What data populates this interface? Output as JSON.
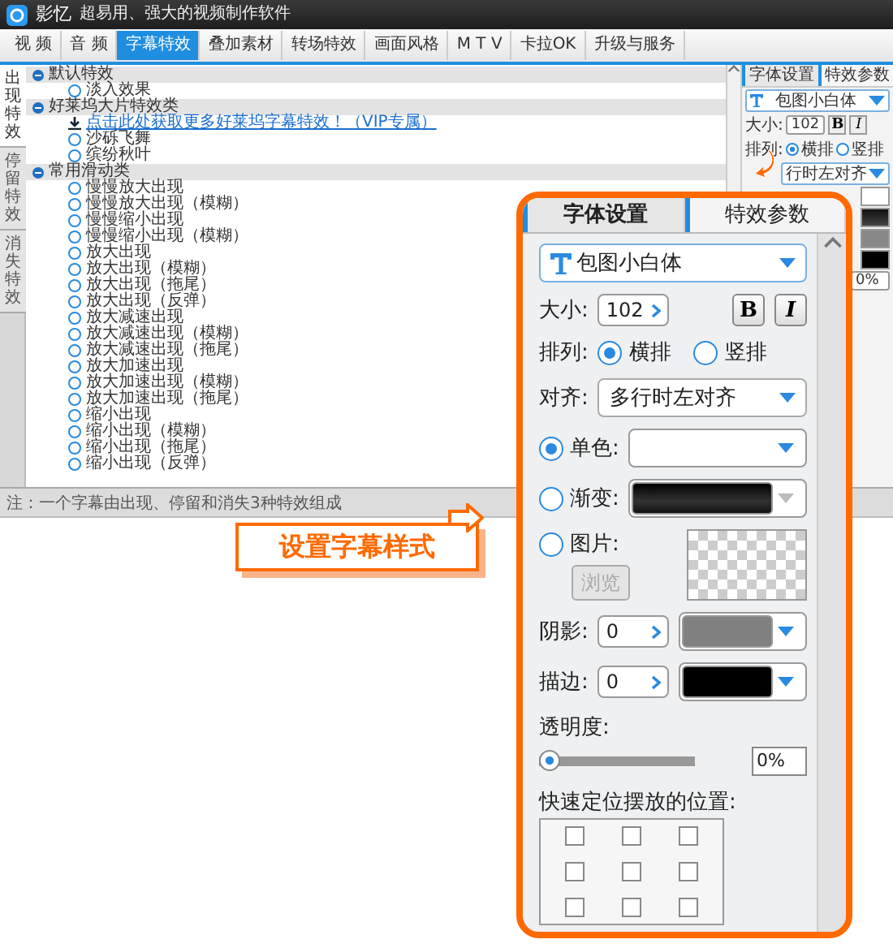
{
  "app": {
    "title": "影忆",
    "subtitle": "超易用、强大的视频制作软件",
    "menu": [
      {
        "label": "视 频",
        "selected": false
      },
      {
        "label": "音 频",
        "selected": false
      },
      {
        "label": "字幕特效",
        "selected": true
      },
      {
        "label": "叠加素材",
        "selected": false
      },
      {
        "label": "转场特效",
        "selected": false
      },
      {
        "label": "画面风格",
        "selected": false
      },
      {
        "label": "M T V",
        "selected": false
      },
      {
        "label": "卡拉OK",
        "selected": false
      },
      {
        "label": "升级与服务",
        "selected": false
      }
    ],
    "side_tabs": [
      {
        "label": "出现特效",
        "selected": true
      },
      {
        "label": "停留特效",
        "selected": false
      },
      {
        "label": "消失特效",
        "selected": false
      }
    ],
    "groups": [
      {
        "title": "默认特效",
        "items": [
          {
            "kind": "radio",
            "label": "淡入效果",
            "selected": false
          }
        ]
      },
      {
        "title": "好莱坞大片特效类",
        "items": [
          {
            "kind": "link",
            "label": "点击此处获取更多好莱坞字幕特效！（VIP专属）"
          },
          {
            "kind": "radio",
            "label": "沙砾飞舞",
            "selected": false
          },
          {
            "kind": "radio",
            "label": "缤纷秋叶",
            "selected": false
          }
        ]
      },
      {
        "title": "常用滑动类",
        "items": [
          {
            "kind": "radio",
            "label": "慢慢放大出现",
            "selected": false
          },
          {
            "kind": "radio",
            "label": "慢慢放大出现（模糊）",
            "selected": false
          },
          {
            "kind": "radio",
            "label": "慢慢缩小出现",
            "selected": false
          },
          {
            "kind": "radio",
            "label": "慢慢缩小出现（模糊）",
            "selected": false
          },
          {
            "kind": "radio",
            "label": "放大出现",
            "selected": false
          },
          {
            "kind": "radio",
            "label": "放大出现（模糊）",
            "selected": false
          },
          {
            "kind": "radio",
            "label": "放大出现（拖尾）",
            "selected": false
          },
          {
            "kind": "radio",
            "label": "放大出现（反弹）",
            "selected": false
          },
          {
            "kind": "radio",
            "label": "放大减速出现",
            "selected": false
          },
          {
            "kind": "radio",
            "label": "放大减速出现（模糊）",
            "selected": false
          },
          {
            "kind": "radio",
            "label": "放大减速出现（拖尾）",
            "selected": false
          },
          {
            "kind": "radio",
            "label": "放大加速出现",
            "selected": false
          },
          {
            "kind": "radio",
            "label": "放大加速出现（模糊）",
            "selected": false
          },
          {
            "kind": "radio",
            "label": "放大加速出现（拖尾）",
            "selected": false
          },
          {
            "kind": "radio",
            "label": "缩小出现",
            "selected": false
          },
          {
            "kind": "radio",
            "label": "缩小出现（模糊）",
            "selected": false
          },
          {
            "kind": "radio",
            "label": "缩小出现（拖尾）",
            "selected": false
          },
          {
            "kind": "radio",
            "label": "缩小出现（反弹）",
            "selected": false
          }
        ]
      }
    ],
    "note": "注：一个字幕由出现、停留和消失3种特效组成"
  },
  "small_panel": {
    "tabs": [
      {
        "label": "字体设置",
        "selected": true
      },
      {
        "label": "特效参数",
        "selected": false
      }
    ],
    "font": "包图小白体",
    "size_label": "大小:",
    "size": "102",
    "bold": "B",
    "italic": "I",
    "arrangement_label": "排列:",
    "arrangement": [
      {
        "label": "横排",
        "selected": true
      },
      {
        "label": "竖排",
        "selected": false
      }
    ],
    "align": "行时左对齐",
    "opacity_value": "0%"
  },
  "callout": {
    "label": "设置字幕样式",
    "tabs": [
      {
        "label": "字体设置",
        "selected": true
      },
      {
        "label": "特效参数",
        "selected": false
      }
    ],
    "font": "包图小白体",
    "size_label": "大小:",
    "size": "102",
    "bold": "B",
    "italic": "I",
    "arrangement_label": "排列:",
    "arrangement": [
      {
        "label": "横排",
        "selected": true
      },
      {
        "label": "竖排",
        "selected": false
      }
    ],
    "align_label": "对齐:",
    "align": "多行时左对齐",
    "fill": [
      {
        "kind": "solid",
        "label": "单色:",
        "selected": true
      },
      {
        "kind": "gradient",
        "label": "渐变:",
        "selected": false
      },
      {
        "kind": "image",
        "label": "图片:",
        "selected": false
      }
    ],
    "browse": {
      "label": "浏览",
      "disabled": true
    },
    "shadow": {
      "label": "阴影:",
      "value": "0",
      "color": "#808080"
    },
    "stroke": {
      "label": "描边:",
      "value": "0",
      "color": "#000000"
    },
    "opacity_label": "透明度:",
    "opacity": {
      "level": 0
    },
    "opacity_value": "0%",
    "position_label": "快速定位摆放的位置:",
    "positions": [
      {
        "checked": false
      },
      {
        "checked": false
      },
      {
        "checked": false
      },
      {
        "checked": false
      },
      {
        "checked": false
      },
      {
        "checked": false
      },
      {
        "checked": false
      },
      {
        "checked": false
      },
      {
        "checked": false
      }
    ]
  }
}
